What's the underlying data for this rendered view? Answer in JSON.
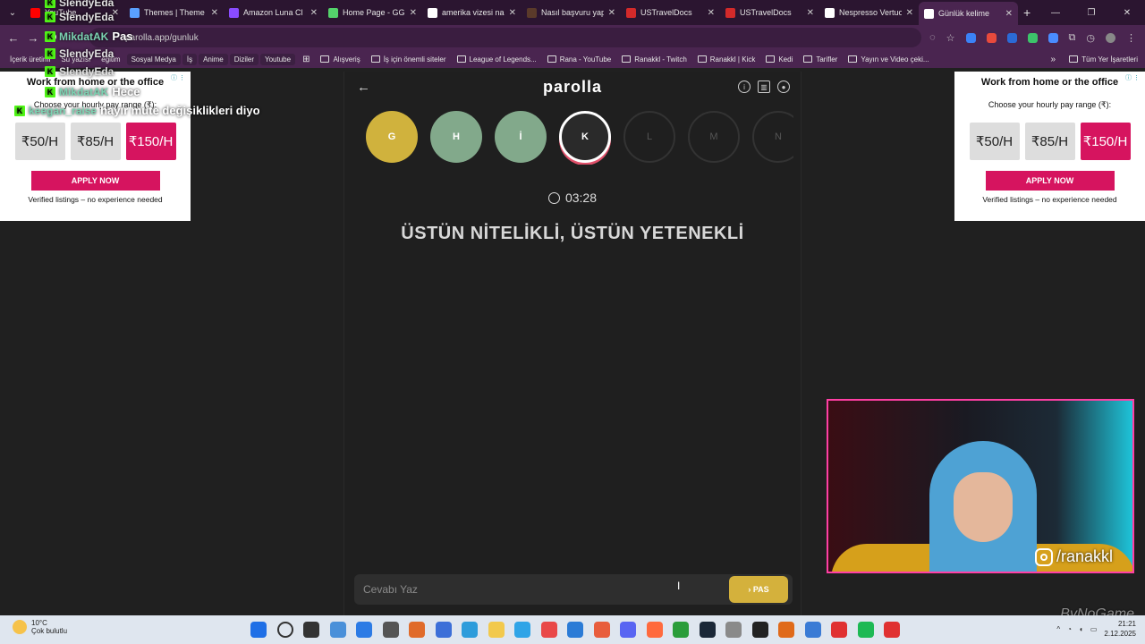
{
  "browser": {
    "tabs": [
      {
        "title": "YouTube",
        "color": "#ff0000"
      },
      {
        "title": "Themes | Theme",
        "color": "#5aa0ff"
      },
      {
        "title": "Amazon Luna Cl",
        "color": "#8a4cff"
      },
      {
        "title": "Home Page - GG",
        "color": "#54d26b"
      },
      {
        "title": "amerika vizesi na",
        "color": "#ffffff"
      },
      {
        "title": "Nasıl başvuru yap",
        "color": "#5a3a2a"
      },
      {
        "title": "USTravelDocs",
        "color": "#d32a2a"
      },
      {
        "title": "USTravelDocs",
        "color": "#d32a2a"
      },
      {
        "title": "Nespresso Vertuo",
        "color": "#ffffff"
      },
      {
        "title": "Günlük kelime",
        "color": "#ffffff"
      }
    ],
    "url": "parolla.app/gunluk",
    "bookmarks": [
      "İçerik üretimi",
      "Su yazısı",
      "eğitim",
      "Sosyal Medya",
      "İş",
      "Anime",
      "Diziler",
      "Youtube"
    ],
    "bookmark_folders": [
      "Alışveriş",
      "İş için önemli siteler",
      "League of Legends...",
      "Rana - YouTube",
      "Ranakkl - Twitch",
      "Ranakkl | Kick",
      "Kedi",
      "Tarifler",
      "Yayın ve Video çeki..."
    ],
    "all_bookmarks": "Tüm Yer İşaretleri"
  },
  "ad": {
    "title": "Work from home or the office",
    "subtitle": "Choose your hourly pay range (₹):",
    "pays": [
      "₹50/H",
      "₹85/H",
      "₹150/H"
    ],
    "apply": "APPLY NOW",
    "verified": "Verified listings – no experience needed",
    "info": "ⓘ ⋮"
  },
  "game": {
    "logo": "parolla",
    "letters": [
      {
        "letter": "G",
        "state": "yellow"
      },
      {
        "letter": "H",
        "state": "green"
      },
      {
        "letter": "İ",
        "state": "green"
      },
      {
        "letter": "K",
        "state": "current"
      },
      {
        "letter": "L",
        "state": "future"
      },
      {
        "letter": "M",
        "state": "future"
      },
      {
        "letter": "N",
        "state": "future"
      }
    ],
    "timer": "03:28",
    "clue": "ÜSTÜN NİTELİKLİ, ÜSTÜN YETENEKLİ",
    "answer_placeholder": "Cevabı Yaz",
    "pass_label": "PAS"
  },
  "chat": [
    {
      "user": "SlendyEda",
      "msg": "",
      "color": "grey"
    },
    {
      "user": "SlendyEda",
      "msg": "",
      "color": "grey"
    },
    {
      "user": "MikdatAK",
      "msg": "Pas",
      "color": "green"
    },
    {
      "user": "SlendyEda",
      "msg": "",
      "color": "grey"
    },
    {
      "user": "SlendyEda",
      "msg": "",
      "color": "grey"
    },
    {
      "user": "MikdatAK",
      "msg": "Hece",
      "color": "green"
    },
    {
      "user": "keegan_raise",
      "msg": "hayır mute değişiklikleri diyo",
      "color": "green"
    }
  ],
  "stream": {
    "instagram": "/ranakkl",
    "watermark": "ByNoGame"
  },
  "taskbar": {
    "temp": "10°C",
    "weather": "Çok bulutlu",
    "time": "21:21",
    "date": "2.12.2025"
  }
}
